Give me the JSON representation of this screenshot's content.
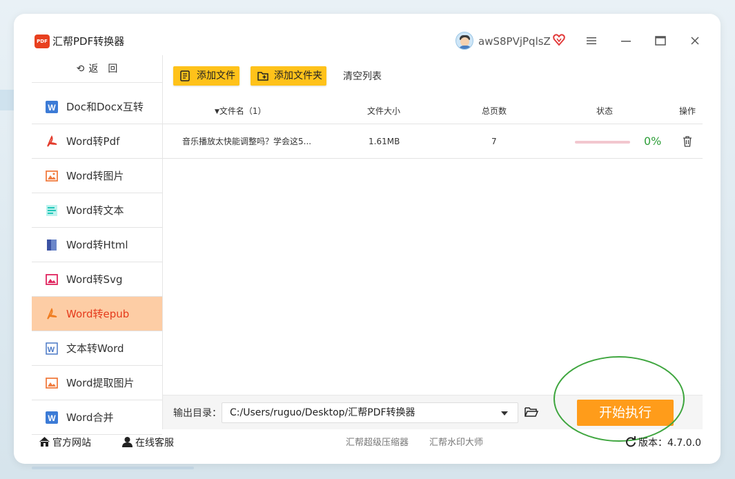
{
  "app": {
    "title": "汇帮PDF转换器",
    "logo_text": "PDF",
    "username": "awS8PVjPqlsZ",
    "window_controls": [
      "menu-icon",
      "minimize-icon",
      "maximize-icon",
      "close-icon"
    ]
  },
  "sidebar": {
    "back_label": "返　回",
    "items": [
      {
        "label": "Doc和Docx互转",
        "icon": "word-icon",
        "active": false
      },
      {
        "label": "Word转Pdf",
        "icon": "pdf-icon",
        "active": false
      },
      {
        "label": "Word转图片",
        "icon": "image-icon",
        "active": false
      },
      {
        "label": "Word转文本",
        "icon": "text-icon",
        "active": false
      },
      {
        "label": "Word转Html",
        "icon": "html-icon",
        "active": false
      },
      {
        "label": "Word转Svg",
        "icon": "svg-icon",
        "active": false
      },
      {
        "label": "Word转epub",
        "icon": "epub-icon",
        "active": true
      },
      {
        "label": "文本转Word",
        "icon": "text-to-word-icon",
        "active": false
      },
      {
        "label": "Word提取图片",
        "icon": "extract-image-icon",
        "active": false
      },
      {
        "label": "Word合并",
        "icon": "merge-icon",
        "active": false
      }
    ]
  },
  "toolbar": {
    "add_file": "添加文件",
    "add_folder": "添加文件夹",
    "clear_list": "清空列表"
  },
  "table": {
    "headers": {
      "name": "文件名（1）",
      "size": "文件大小",
      "pages": "总页数",
      "status": "状态",
      "action": "操作"
    },
    "rows": [
      {
        "name": "音乐播放太快能调整吗？学会这5...",
        "size": "1.61MB",
        "pages": "7",
        "progress": 0,
        "percent": "0%"
      }
    ]
  },
  "output": {
    "label": "输出目录：",
    "path": "C:/Users/ruguo/Desktop/汇帮PDF转换器",
    "start_button": "开始执行"
  },
  "footer": {
    "website": "官方网站",
    "support": "在线客服",
    "link1": "汇帮超级压缩器",
    "link2": "汇帮水印大师",
    "version_label": "版本：",
    "version": "4.7.0.0"
  },
  "colors": {
    "accent": "#ffc21a",
    "active_bg": "#fdcda5",
    "active_text": "#e53a1b",
    "start_button": "#ff9c1a",
    "percent_green": "#2e9e39",
    "annotation_circle": "#3fa63f"
  }
}
